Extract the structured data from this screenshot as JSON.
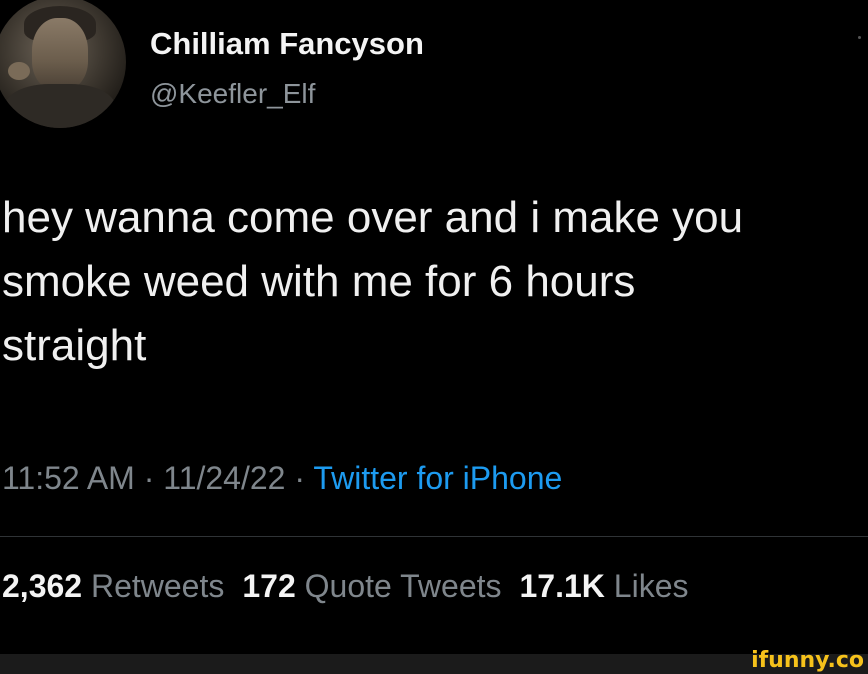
{
  "author": {
    "name": "Chilliam Fancyson",
    "handle": "@Keefler_Elf"
  },
  "tweet": {
    "lines": [
      "hey wanna come over and i make you",
      "smoke weed with me for 6 hours",
      "straight"
    ]
  },
  "meta": {
    "time": "11:52 AM",
    "separator": " · ",
    "date": "11/24/22",
    "source": "Twitter for iPhone"
  },
  "stats": {
    "retweets_count": "2,362",
    "retweets_label": "Retweets",
    "quotes_count": "172",
    "quotes_label": "Quote Tweets",
    "likes_count": "17.1K",
    "likes_label": "Likes"
  },
  "watermark": "ifunny.co",
  "colors": {
    "background": "#000000",
    "text": "#f0f0f0",
    "muted": "#7f868c",
    "link": "#1d9bf0",
    "watermark": "#f6c21b"
  }
}
